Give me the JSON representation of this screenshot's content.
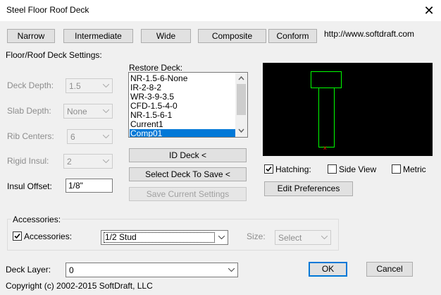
{
  "window": {
    "title": "Steel Floor Roof Deck",
    "close_glyph": "✕"
  },
  "top_buttons": [
    "Narrow",
    "Intermediate",
    "Wide",
    "Composite",
    "Conform"
  ],
  "website": "http://www.softdraft.com",
  "settings": {
    "group_label": "Floor/Roof Deck Settings:",
    "deck_depth": {
      "label": "Deck Depth:",
      "value": "1.5",
      "enabled": false
    },
    "slab_depth": {
      "label": "Slab Depth:",
      "value": "None",
      "enabled": false
    },
    "rib_centers": {
      "label": "Rib Centers:",
      "value": "6",
      "enabled": false
    },
    "rigid_insul": {
      "label": "Rigid Insul:",
      "value": "2",
      "enabled": false
    },
    "insul_offset": {
      "label": "Insul Offset:",
      "value": "1/8\""
    }
  },
  "restore_deck": {
    "label": "Restore Deck:",
    "items": [
      "NR-1.5-6-None",
      "IR-2-8-2",
      "WR-3-9-3.5",
      "CFD-1.5-4-0",
      "NR-1.5-6-1",
      "Current1",
      "Comp01"
    ],
    "selected_index": 6
  },
  "actions": {
    "id_deck": "ID Deck <",
    "select_deck_to_save": "Select Deck To Save <",
    "save_current_settings": "Save Current Settings"
  },
  "preview": {
    "background": "#000000",
    "outline_color": "#00ff00",
    "marker_color": "#ff0000"
  },
  "view_options": {
    "hatching": {
      "label": "Hatching:",
      "checked": true
    },
    "side_view": {
      "label": "Side View",
      "checked": false
    },
    "metric": {
      "label": "Metric",
      "checked": false
    }
  },
  "edit_preferences": "Edit Preferences",
  "accessories": {
    "group_label": "Accessories:",
    "checkbox_label": "Accessories:",
    "checked": true,
    "type_value": "1/2 Stud",
    "size_label": "Size:",
    "size_value": "Select"
  },
  "deck_layer": {
    "label": "Deck Layer:",
    "value": "0"
  },
  "ok": "OK",
  "cancel": "Cancel",
  "copyright": "Copyright (c) 2002-2015 SoftDraft, LLC",
  "colors": {
    "accent": "#0078d7",
    "face": "#f0f0f0",
    "button": "#e1e1e1"
  }
}
